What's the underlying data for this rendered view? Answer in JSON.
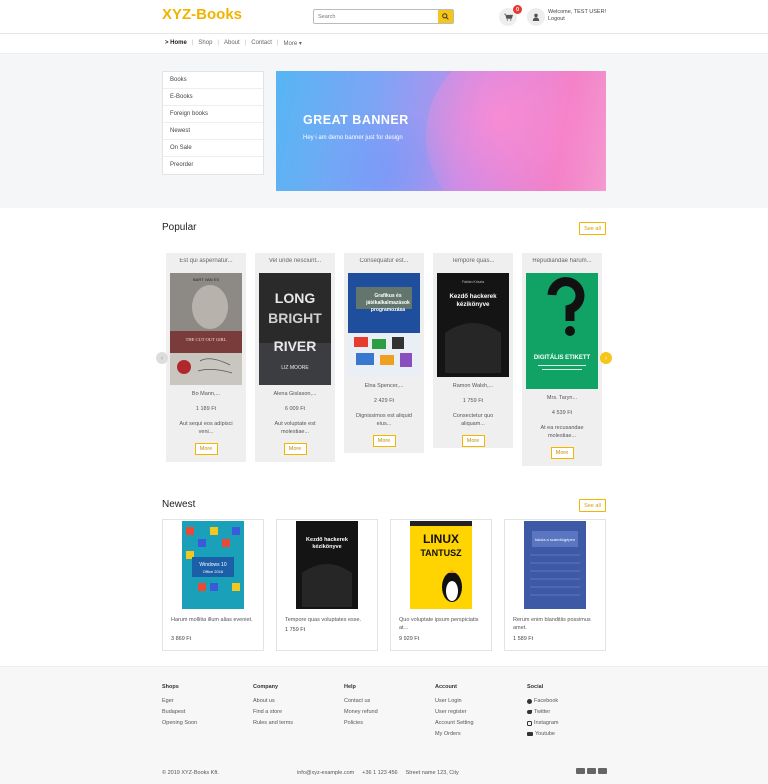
{
  "header": {
    "logo": "XYZ-Books",
    "search_placeholder": "Search",
    "cart_count": "0",
    "welcome": "Welcome, TEST USER!",
    "logout": "Logout"
  },
  "nav": {
    "items": [
      "> Home",
      "Shop",
      "About",
      "Contact",
      "More ▾"
    ]
  },
  "categories": [
    "Books",
    "E-Books",
    "Foreign books",
    "Newest",
    "On Sale",
    "Preorder"
  ],
  "banner": {
    "title": "GREAT BANNER",
    "subtitle": "Hey i am demo banner just for design"
  },
  "popular": {
    "title": "Popular",
    "see_all": "See all",
    "more_label": "More",
    "items": [
      {
        "title": "Est qui aspernatur...",
        "author": "Bo Mann,...",
        "price": "1 189 Ft",
        "desc": "Aut sequi eos adipisci veni...",
        "cover_title": "THE CUT OUT GIRL",
        "cover_author": "BART VAN ES"
      },
      {
        "title": "Vel unde nesciunt...",
        "author": "Alena Gislason,...",
        "price": "6 009 Ft",
        "desc": "Aut voluptate est molestiae...",
        "cover_title": "LONG BRIGHT RIVER",
        "cover_author": "LIZ MOORE"
      },
      {
        "title": "Consequatur est...",
        "author": "Elna Spencer,...",
        "price": "2 429 Ft",
        "desc": "Dignissimos est aliquid eius...",
        "cover_title": "Grafikus és játékalkalmazások programozása",
        "cover_author": ""
      },
      {
        "title": "Tempore quas...",
        "author": "Ramon Walsh,...",
        "price": "1 759 Ft",
        "desc": "Consectetur quo aliquam...",
        "cover_title": "Kezdő hackerek kézikönyve",
        "cover_author": "Fábián Kriszta"
      },
      {
        "title": "Repudiandae harum...",
        "author": "Mrs. Taryn...",
        "price": "4 539 Ft",
        "desc": "At ea recusandae molestiae...",
        "cover_title": "DIGITÁLIS ETIKETT",
        "cover_author": ""
      }
    ]
  },
  "newest": {
    "title": "Newest",
    "see_all": "See all",
    "items": [
      {
        "desc": "Harum mollitia illum alias eveniet.",
        "price": "3 869 Ft",
        "cover_title": "Windows 10 és Office 2016"
      },
      {
        "desc": "Tempore quas voluptates esse.",
        "price": "1 759 Ft",
        "cover_title": "Kezdő hackerek kézikönyve"
      },
      {
        "desc": "Quo voluptate ipsum perspiciatis at...",
        "price": "9 929 Ft",
        "cover_title": "LINUX TANTUSZ"
      },
      {
        "desc": "Rerum enim blanditiis possimus amet.",
        "price": "1 589 Ft",
        "cover_title": "Iskola a számítógépen"
      }
    ]
  },
  "footer": {
    "columns": [
      {
        "heading": "Shops",
        "links": [
          "Eger",
          "Budapest",
          "Opening Soon"
        ]
      },
      {
        "heading": "Company",
        "links": [
          "About us",
          "Find a store",
          "Rules and terms"
        ]
      },
      {
        "heading": "Help",
        "links": [
          "Contact us",
          "Money refund",
          "Policies"
        ]
      },
      {
        "heading": "Account",
        "links": [
          "User Login",
          "User register",
          "Account Setting",
          "My Orders"
        ]
      },
      {
        "heading": "Social",
        "links": [
          "Facebook",
          "Twitter",
          "Instagram",
          "Youtube"
        ]
      }
    ],
    "copyright": "© 2019 XYZ-Books Kft.",
    "email": "info@xyz-example.com",
    "phone": "+36 1 123 456",
    "address": "Street name 123, City"
  },
  "colors": {
    "brand": "#f0b400",
    "accent_border": "#f2b600",
    "badge": "#e53935"
  }
}
